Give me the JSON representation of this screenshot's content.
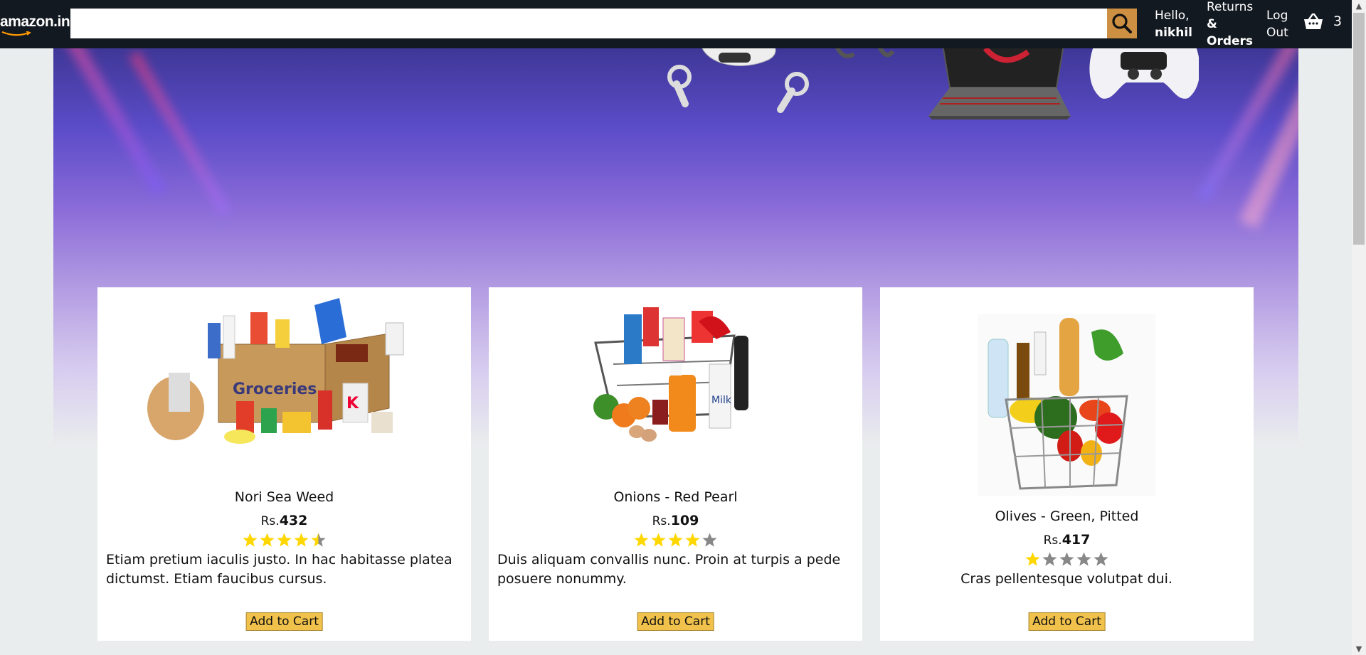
{
  "header": {
    "logo_text": "amazon.in",
    "search_placeholder": "",
    "search_value": "",
    "greeting_line1": "Hello,",
    "greeting_line2": "nikhil",
    "returns_line1": "Returns",
    "returns_line2": "&",
    "returns_line3": "Orders",
    "logout_line1": "Log",
    "logout_line2": "Out",
    "basket_count": "3",
    "accent_color": "#cd9042",
    "bg_color": "#131921"
  },
  "products": [
    {
      "title": "Nori Sea Weed",
      "currency": "Rs.",
      "price": "432",
      "rating": 4.5,
      "description": "Etiam pretium iaculis justo. In hac habitasse platea dictumst. Etiam faucibus cursus.",
      "button": "Add to Cart",
      "image": "groceries-box-image"
    },
    {
      "title": "Onions - Red Pearl",
      "currency": "Rs.",
      "price": "109",
      "rating": 4,
      "description": "Duis aliquam convallis nunc. Proin at turpis a pede posuere nonummy.",
      "button": "Add to Cart",
      "image": "grocery-cart-image"
    },
    {
      "title": "Olives - Green, Pitted",
      "currency": "Rs.",
      "price": "417",
      "rating": 1,
      "description": "Cras pellentesque volutpat dui.",
      "button": "Add to Cart",
      "image": "vegetable-basket-image"
    }
  ],
  "colors": {
    "star_filled": "#ffd700",
    "star_empty": "#888888",
    "button_bg": "#f0c14b"
  }
}
